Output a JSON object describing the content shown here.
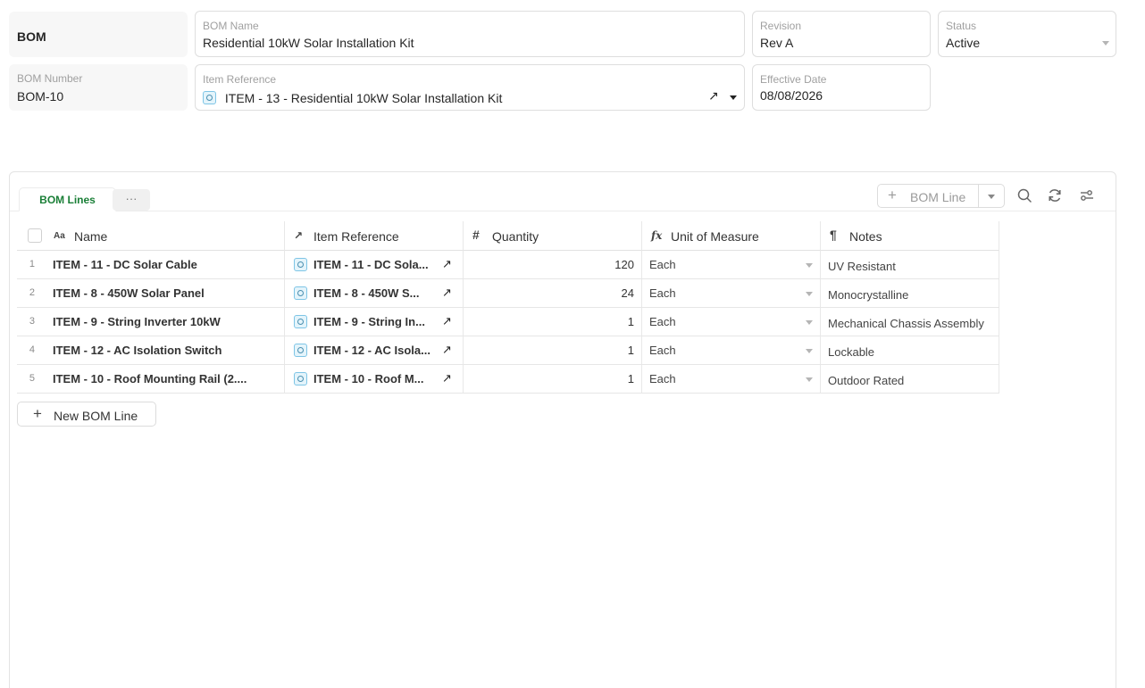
{
  "form": {
    "title": "BOM",
    "bom_name": {
      "label": "BOM Name",
      "value": "Residential 10kW Solar Installation Kit"
    },
    "revision": {
      "label": "Revision",
      "value": "Rev A"
    },
    "status": {
      "label": "Status",
      "value": "Active"
    },
    "bom_number": {
      "label": "BOM Number",
      "value": "BOM-10"
    },
    "item_reference": {
      "label": "Item Reference",
      "value": "ITEM - 13 - Residential 10kW Solar Installation Kit"
    },
    "effective_date": {
      "label": "Effective Date",
      "value": "08/08/2026"
    }
  },
  "tabs": {
    "active": "BOM Lines",
    "more": "···"
  },
  "toolbar": {
    "add_label": "BOM Line",
    "icons": [
      "search-icon",
      "refresh-icon",
      "settings-icon"
    ]
  },
  "grid": {
    "columns": [
      {
        "icon": "Aa",
        "label": "Name"
      },
      {
        "icon": "↗",
        "label": "Item Reference"
      },
      {
        "icon": "#",
        "label": "Quantity"
      },
      {
        "icon": "fx",
        "label": "Unit of Measure"
      },
      {
        "icon": "¶",
        "label": "Notes"
      }
    ],
    "rows": [
      {
        "num": "1",
        "name": "ITEM - 11 - DC Solar Cable",
        "ref": "ITEM - 11 - DC Sola...",
        "qty": "120",
        "uom": "Each",
        "notes": "UV Resistant"
      },
      {
        "num": "2",
        "name": "ITEM - 8 - 450W Solar Panel",
        "ref": "ITEM - 8 - 450W S...",
        "qty": "24",
        "uom": "Each",
        "notes": "Monocrystalline"
      },
      {
        "num": "3",
        "name": "ITEM - 9 - String Inverter 10kW",
        "ref": "ITEM - 9 - String In...",
        "qty": "1",
        "uom": "Each",
        "notes": "Mechanical Chassis Assembly"
      },
      {
        "num": "4",
        "name": "ITEM - 12 - AC Isolation Switch",
        "ref": "ITEM - 12 - AC Isola...",
        "qty": "1",
        "uom": "Each",
        "notes": "Lockable"
      },
      {
        "num": "5",
        "name": "ITEM - 10 - Roof Mounting Rail (2....",
        "ref": "ITEM - 10 - Roof M...",
        "qty": "1",
        "uom": "Each",
        "notes": "Outdoor Rated"
      }
    ],
    "new_line_label": "New BOM Line"
  },
  "colors": {
    "accent_green": "#1a7f37",
    "border": "#dedede",
    "item_icon": "#7ec5e6"
  }
}
